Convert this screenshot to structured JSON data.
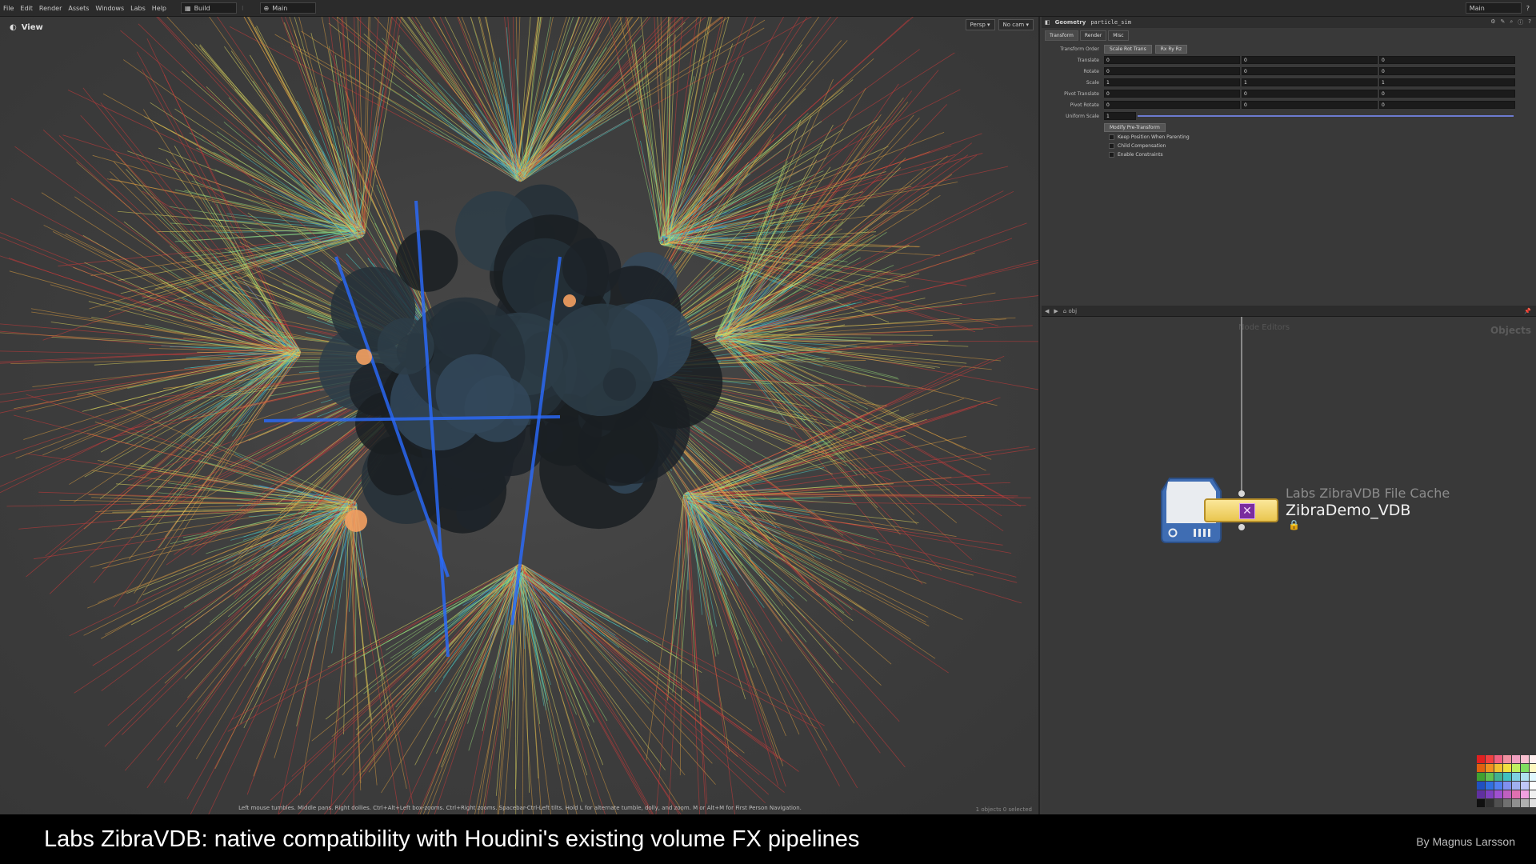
{
  "menubar": {
    "items": [
      "File",
      "Edit",
      "Render",
      "Assets",
      "Windows",
      "Labs",
      "Help"
    ],
    "desktop": "Build",
    "pane": "Main",
    "right_desktop": "Main"
  },
  "viewport": {
    "label": "View",
    "camera": "Persp ▾",
    "camera2": "No cam ▾",
    "hint": "Left mouse tumbles. Middle pans. Right dollies. Ctrl+Alt+Left box-zooms. Ctrl+Right zooms. Spacebar-Ctrl-Left tilts. Hold L for alternate tumble, dolly, and zoom. M or Alt+M for First Person Navigation.",
    "object_count": "1 objects  0 selected"
  },
  "params": {
    "node_type": "Geometry",
    "node_name": "particle_sim",
    "tabs": [
      "Transform",
      "Render",
      "Misc"
    ],
    "transform_order_label": "Transform Order",
    "transform_order": "Scale Rot Trans",
    "rotate_order": "Rx Ry Rz",
    "rows": [
      {
        "label": "Translate",
        "values": [
          "0",
          "0",
          "0"
        ]
      },
      {
        "label": "Rotate",
        "values": [
          "0",
          "0",
          "0"
        ]
      },
      {
        "label": "Scale",
        "values": [
          "1",
          "1",
          "1"
        ]
      },
      {
        "label": "Pivot Translate",
        "values": [
          "0",
          "0",
          "0"
        ]
      },
      {
        "label": "Pivot Rotate",
        "values": [
          "0",
          "0",
          "0"
        ]
      }
    ],
    "uniform_scale_label": "Uniform Scale",
    "uniform_scale": "1",
    "modify_button": "Modify Pre-Transform",
    "checkboxes": [
      "Keep Position When Parenting",
      "Child Compensation",
      "Enable Constraints"
    ]
  },
  "network": {
    "path_label": "Node Editors",
    "context": "Objects",
    "node_type": "Labs ZibraVDB File Cache",
    "node_name": "ZibraDemo_VDB",
    "palette_colors": [
      "#e02020",
      "#f04040",
      "#f06080",
      "#f090a0",
      "#f0a0c0",
      "#f8c0d0",
      "#fff0f0",
      "#e06010",
      "#f09020",
      "#f0c030",
      "#f0e040",
      "#c0f060",
      "#80e060",
      "#fff8c0",
      "#40a030",
      "#60c050",
      "#40b090",
      "#40c0c0",
      "#80d0e0",
      "#b0e0f0",
      "#e0f8ff",
      "#2050c0",
      "#3070e0",
      "#5080f0",
      "#8090f0",
      "#a0b0f0",
      "#c0c8f8",
      "#ffffff",
      "#6030a0",
      "#8040c0",
      "#a050d0",
      "#c060c0",
      "#e070b0",
      "#f0a0e0",
      "#f0f0f0",
      "#101010",
      "#303030",
      "#505050",
      "#707070",
      "#909090",
      "#b0b0b0",
      "#e0e0e0"
    ]
  },
  "caption": {
    "title": "Labs ZibraVDB: native compatibility with Houdini's existing volume FX pipelines",
    "credit": "By Magnus Larsson"
  }
}
